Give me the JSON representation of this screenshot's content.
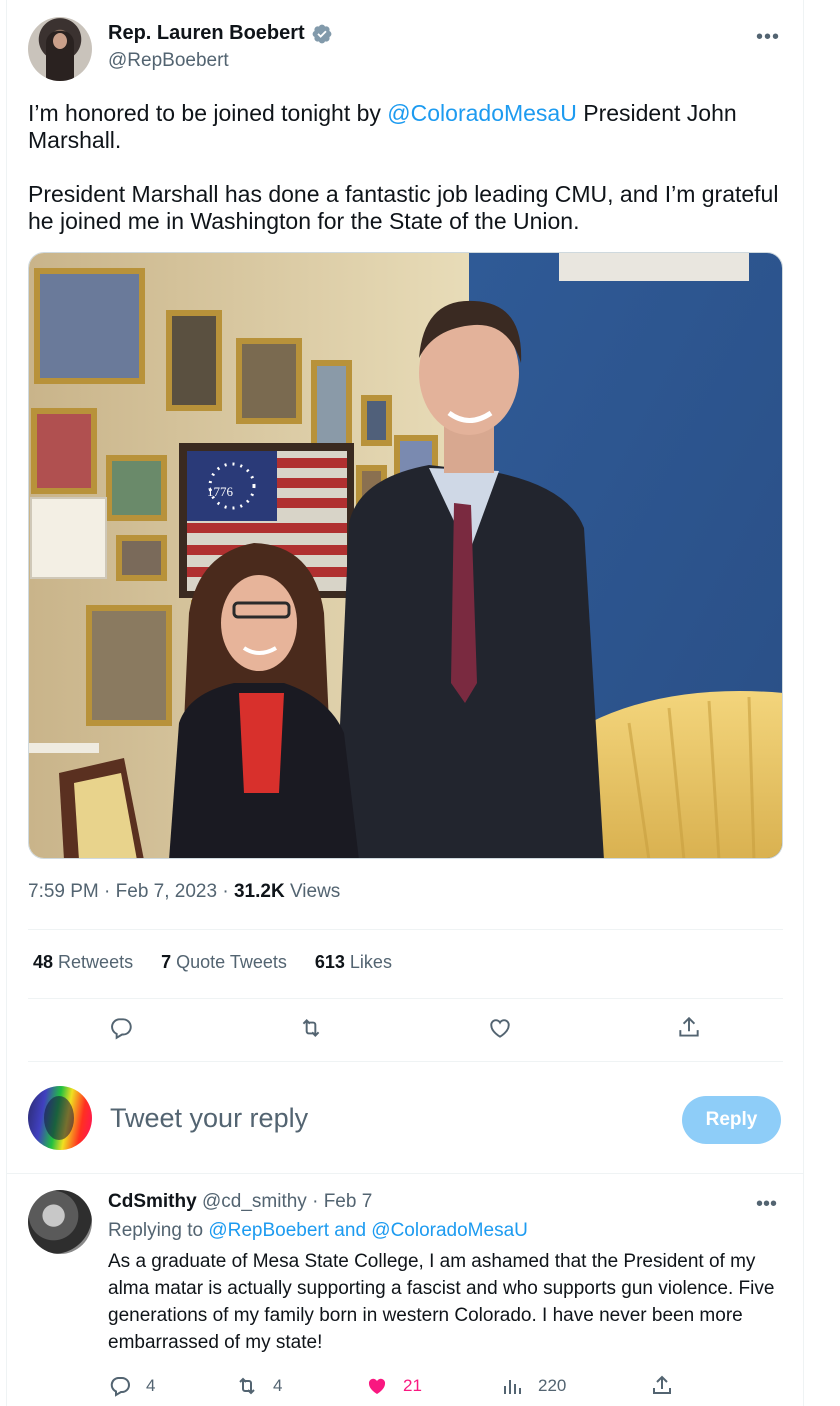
{
  "tweet": {
    "author": {
      "display_name": "Rep. Lauren Boebert",
      "handle": "@RepBoebert",
      "verified_icon": "verified-badge-icon"
    },
    "text": {
      "line1_pre": "I’m honored to be joined tonight by ",
      "line1_mention": "@ColoradoMesaU",
      "line1_post": " President John Marshall.",
      "paragraph2": "President Marshall has done a fantastic job leading CMU, and I’m grateful he joined me in Washington for the State of the Union."
    },
    "meta": {
      "time": "7:59 PM",
      "date": "Feb 7, 2023",
      "views_count": "31.2K",
      "views_label": "Views",
      "sep": "·"
    },
    "stats": {
      "retweets_count": "48",
      "retweets_label": "Retweets",
      "quotes_count": "7",
      "quotes_label": "Quote Tweets",
      "likes_count": "613",
      "likes_label": "Likes"
    }
  },
  "composer": {
    "placeholder": "Tweet your reply",
    "button_label": "Reply"
  },
  "reply": {
    "display_name": "CdSmithy",
    "handle": "@cd_smithy",
    "sep": "·",
    "date": "Feb 7",
    "replying_to_label": "Replying to",
    "replying_to_targets": "@RepBoebert and @ColoradoMesaU",
    "text": "As a graduate of Mesa State College, I am ashamed that the President of my alma matar is actually supporting a fascist and who supports gun violence. Five generations of my family born in western Colorado. I have never been more embarrassed of my state!",
    "actions": {
      "replies": "4",
      "retweets": "4",
      "likes": "21",
      "views": "220"
    }
  },
  "colors": {
    "accent": "#1d9bf0",
    "reply_button_disabled": "#8ecdf8",
    "like_active": "#f91880",
    "secondary_text": "#536471"
  }
}
